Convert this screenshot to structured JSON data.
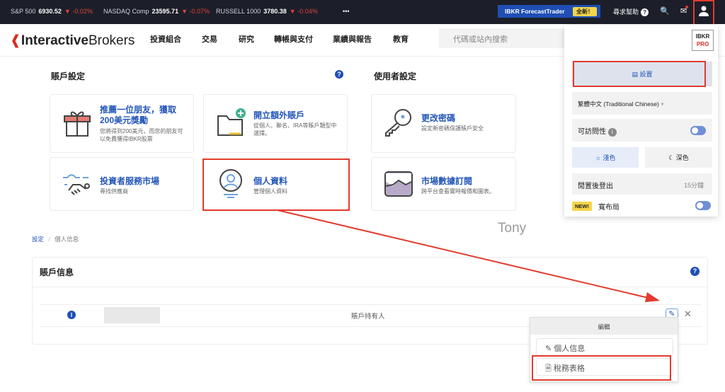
{
  "ticker": [
    {
      "name": "S&P 500",
      "value": "6930.52",
      "change": "-0.02%"
    },
    {
      "name": "NASDAQ Comp",
      "value": "23595.71",
      "change": "-0.07%"
    },
    {
      "name": "RUSSELL 1000",
      "value": "3780.38",
      "change": "-0.04%"
    }
  ],
  "topbar": {
    "more": "•••",
    "forecast": "IBKR ForecastTrader",
    "forecast_badge": "全新！",
    "help": "尋求幫助",
    "help_icon": "?"
  },
  "logo": {
    "bold": "Interactive",
    "light": "Brokers"
  },
  "nav": [
    "投資組合",
    "交易",
    "研究",
    "轉帳與支付",
    "業績與報告",
    "教育"
  ],
  "search": {
    "placeholder": "代碼或站內搜索"
  },
  "account_settings": {
    "title": "賬戶設定",
    "cards": [
      {
        "title": "推薦一位朋友，獲取200美元獎勵",
        "desc": "您將得到200美元，而您的朋友可以免費獲得IBKR股票"
      },
      {
        "title": "開立額外賬戶",
        "desc": "從個人、聯名、IRA等賬戶類型中選擇。"
      },
      {
        "title": "投資者服務市場",
        "desc": "尋找供應商"
      },
      {
        "title": "個人資料",
        "desc": "管理個人資料"
      }
    ]
  },
  "user_settings": {
    "title": "使用者設定",
    "cards": [
      {
        "title": "更改密碼",
        "desc": "設定新密碼保護賬戶安全"
      },
      {
        "title": "市場數據訂閱",
        "desc": "跨平台查看實時報價和圖表。"
      }
    ]
  },
  "panel": {
    "logo_top": "IBKR",
    "logo_bottom": "PRO",
    "settings": "設置",
    "language": "繁體中文 (Traditional Chinese)",
    "accessibility": "可訪問性",
    "light": "淺色",
    "dark": "深色",
    "idle_logout": "閒置後登出",
    "idle_value": "15分鐘",
    "new_badge": "NEW!",
    "wide_layout": "寬布局"
  },
  "annotation": "Tony",
  "breadcrumb": {
    "root": "設定",
    "sep": "/",
    "current": "個人信息"
  },
  "account_info": {
    "title": "賬戶信息",
    "holder_label": "賬戶持有人"
  },
  "edit_menu": {
    "title": "編輯",
    "items": [
      "個人信息",
      "稅務表格"
    ]
  },
  "colors": {
    "accent": "#1f4fb5",
    "highlight": "#e23b2e",
    "topbar": "#1c1f2a"
  }
}
